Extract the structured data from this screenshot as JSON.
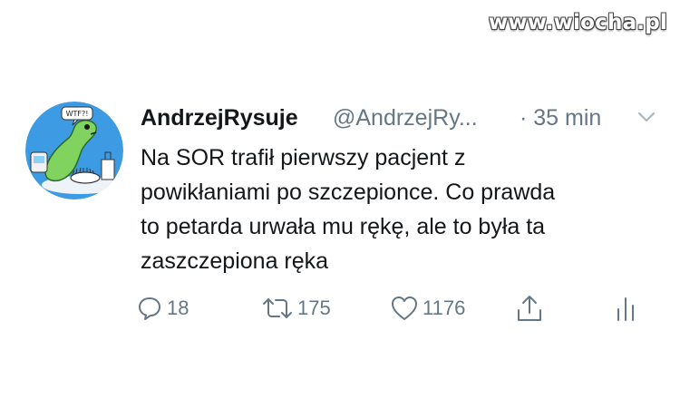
{
  "watermark": "www.wiocha.pl",
  "tweet": {
    "display_name": "AndrzejRysuje",
    "handle": "@AndrzejRy...",
    "time": "· 35 min",
    "text_lines": [
      "Na SOR trafił pierwszy pacjent z",
      "powikłaniami po szczepionce. Co prawda",
      "to petarda urwała mu rękę, ale to była ta",
      "zaszczepiona ręka"
    ],
    "avatar": {
      "bubble_text": "WTF?!",
      "background_color": "#3d9be3",
      "creature_color": "#7fd35e"
    }
  },
  "actions": {
    "reply": {
      "icon": "reply-icon",
      "count": "18"
    },
    "retweet": {
      "icon": "retweet-icon",
      "count": "175"
    },
    "like": {
      "icon": "heart-icon",
      "count": "1176"
    },
    "share": {
      "icon": "share-icon"
    },
    "analytics": {
      "icon": "analytics-icon"
    }
  },
  "colors": {
    "text": "#14171a",
    "secondary": "#657786"
  }
}
